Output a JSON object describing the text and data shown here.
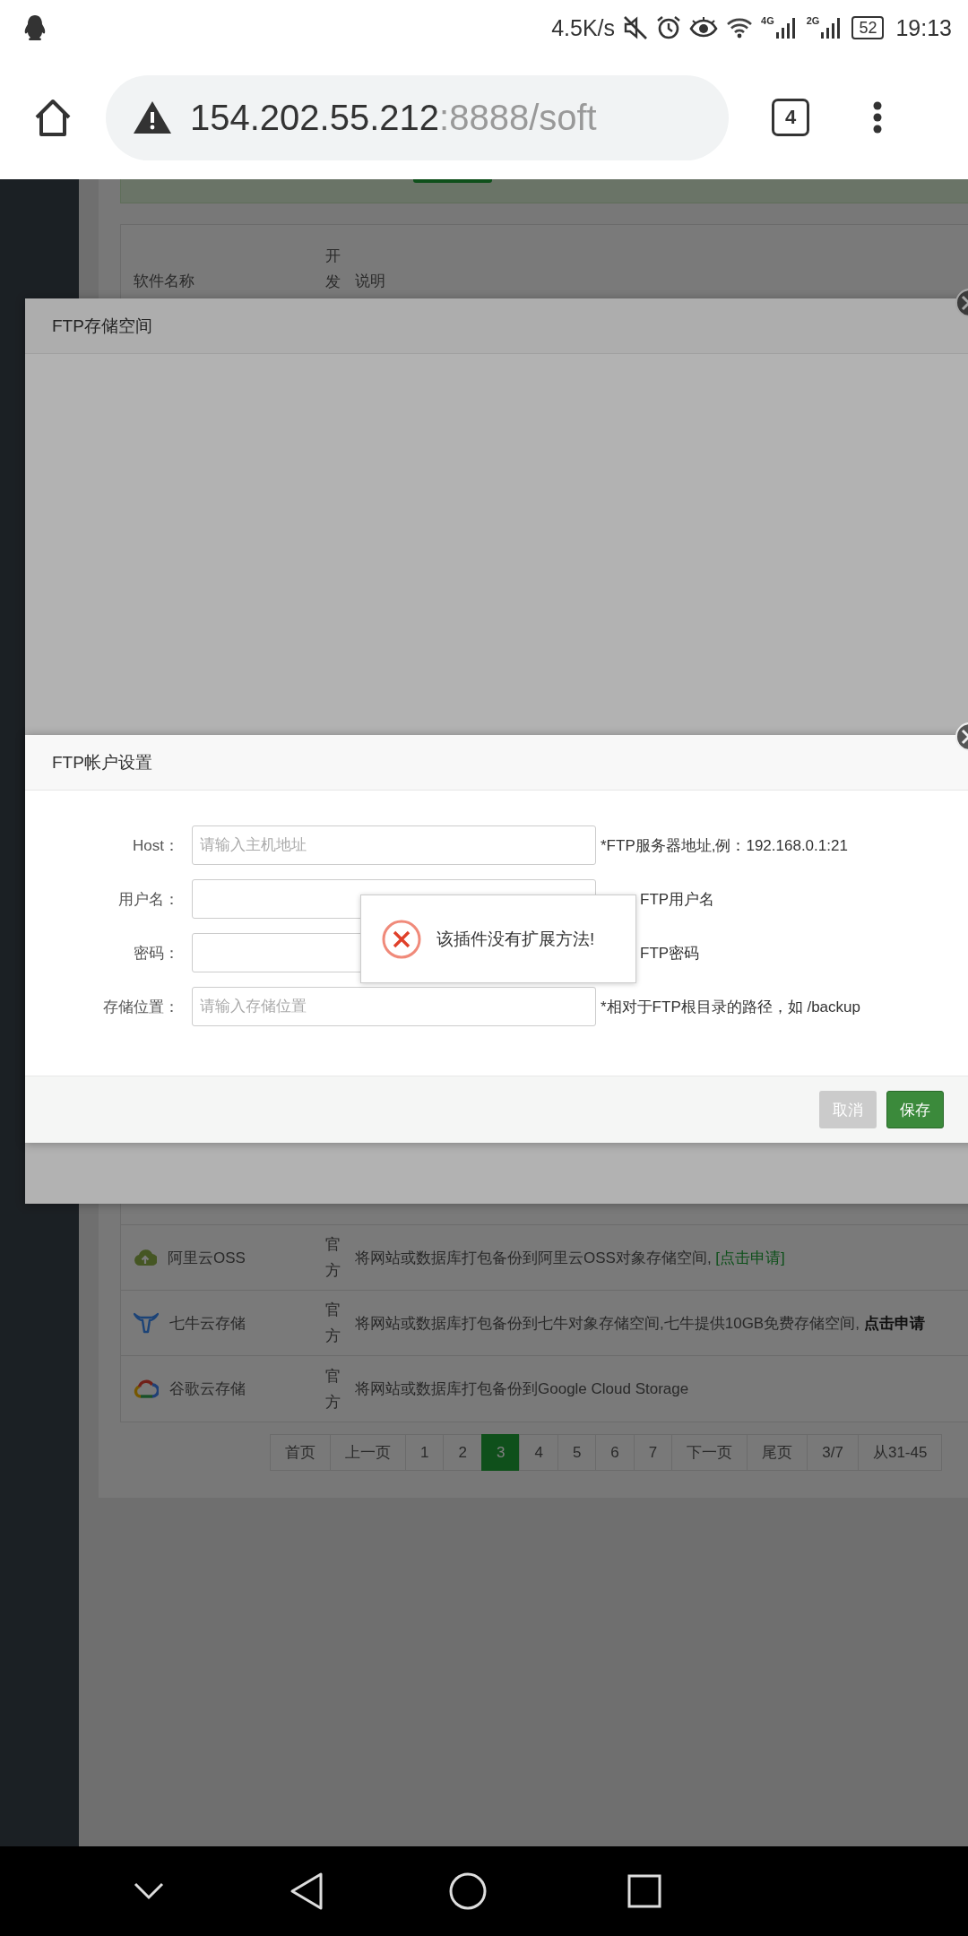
{
  "status_bar": {
    "speed": "4.5K/s",
    "network_1": "4G",
    "network_2": "2G",
    "battery": "52",
    "time": "19:13"
  },
  "address_bar": {
    "host": "154.202.55.212",
    "path": ":8888/soft",
    "tab_count": "4"
  },
  "table": {
    "columns": [
      "软件名称",
      "开发",
      "说明"
    ],
    "rows": [
      {
        "name": "阿里云OSS",
        "developer": "官方",
        "description": "将网站或数据库打包备份到阿里云OSS对象存储空间, ",
        "link": "[点击申请]"
      },
      {
        "name": "七牛云存储",
        "developer": "官方",
        "description": "将网站或数据库打包备份到七牛对象存储空间,七牛提供10GB免费存储空间, **点击申请**"
      },
      {
        "name": "谷歌云存储",
        "developer": "官方",
        "description": "将网站或数据库打包备份到Google Cloud Storage"
      }
    ]
  },
  "pagination": [
    {
      "label": "首页",
      "selected": false
    },
    {
      "label": "上一页",
      "selected": false
    },
    {
      "label": "1",
      "selected": false
    },
    {
      "label": "2",
      "selected": false
    },
    {
      "label": "3",
      "selected": true
    },
    {
      "label": "4",
      "selected": false
    },
    {
      "label": "5",
      "selected": false
    },
    {
      "label": "6",
      "selected": false
    },
    {
      "label": "7",
      "selected": false
    },
    {
      "label": "下一页",
      "selected": false
    },
    {
      "label": "尾页",
      "selected": false
    },
    {
      "label": "3/7",
      "selected": false
    },
    {
      "label": "从31-45",
      "selected": false
    }
  ],
  "storage_dialog": {
    "title": "FTP存储空间"
  },
  "account_dialog": {
    "title": "FTP帐户设置",
    "fields": [
      {
        "label": "Host：",
        "placeholder": "请输入主机地址",
        "hint": "*FTP服务器地址,例：192.168.0.1:21"
      },
      {
        "label": "用户名：",
        "hint": "FTP用户名"
      },
      {
        "label": "密码：",
        "hint": "FTP密码"
      },
      {
        "label": "存储位置：",
        "placeholder": "请输入存储位置",
        "hint": "*相对于FTP根目录的路径，如 /backup"
      }
    ],
    "buttons": [
      {
        "label": "取消",
        "kind": "cancel"
      },
      {
        "label": "保存",
        "kind": "primary"
      }
    ]
  },
  "toast": {
    "message": "该插件没有扩展方法!",
    "kind": "error"
  }
}
